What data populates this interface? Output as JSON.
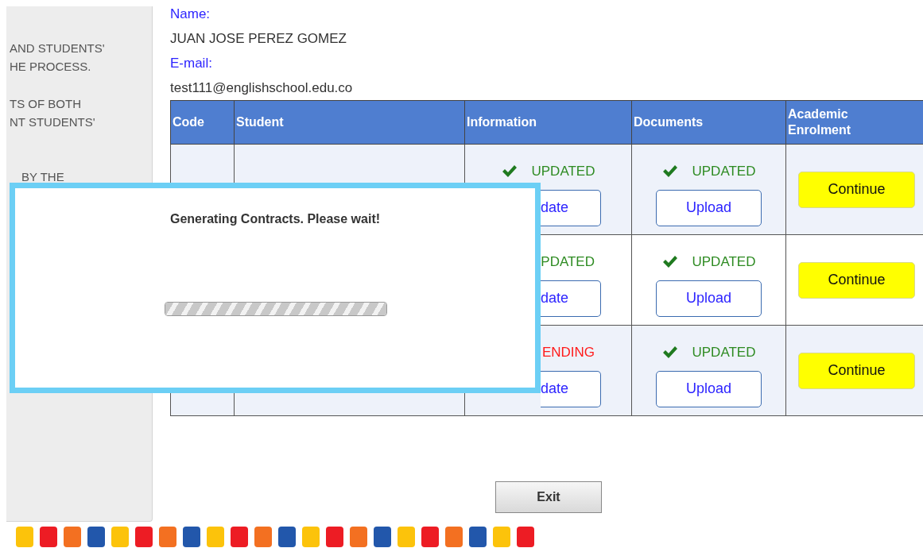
{
  "sidebar": {
    "paragraphs": [
      [
        "AND STUDENTS'",
        "HE PROCESS."
      ],
      [
        "TS OF BOTH",
        "NT STUDENTS'"
      ],
      [
        "BY THE"
      ]
    ]
  },
  "profile": {
    "name_label": "Name:",
    "name": "JUAN JOSE PEREZ GOMEZ",
    "email_label": "E-mail:",
    "email": "test111@englishschool.edu.co"
  },
  "table": {
    "columns": [
      "Code",
      "Student",
      "Information",
      "Documents",
      "Academic Enrolment"
    ],
    "rows": [
      {
        "information": {
          "status": "UPDATED",
          "kind": "updated",
          "button": "date",
          "cut": false,
          "button_cut": true
        },
        "documents": {
          "status": "UPDATED",
          "kind": "updated",
          "button": "Upload"
        },
        "enrolment_button": "Continue"
      },
      {
        "information": {
          "status": "PDATED",
          "kind": "updated",
          "button": "date",
          "cut": true,
          "button_cut": true
        },
        "documents": {
          "status": "UPDATED",
          "kind": "updated",
          "button": "Upload"
        },
        "enrolment_button": "Continue"
      },
      {
        "information": {
          "status": "ENDING",
          "kind": "pending",
          "button": "date",
          "cut": true,
          "button_cut": true
        },
        "documents": {
          "status": "UPDATED",
          "kind": "updated",
          "button": "Upload"
        },
        "enrolment_button": "Continue"
      }
    ]
  },
  "exit_button": "Exit",
  "modal": {
    "message": "Generating Contracts. Please wait!",
    "progress": {
      "level": 1
    }
  },
  "color_strip": [
    {
      "color": "#fcc30b"
    },
    {
      "color": "#ed1c24"
    },
    {
      "color": "#f37021"
    },
    {
      "color": "#2257ab"
    },
    {
      "color": "#fcc30b"
    },
    {
      "color": "#ed1c24"
    },
    {
      "color": "#f37021"
    },
    {
      "color": "#2257ab"
    },
    {
      "color": "#fcc30b"
    },
    {
      "color": "#ed1c24"
    },
    {
      "color": "#f37021"
    },
    {
      "color": "#2257ab"
    },
    {
      "color": "#fcc30b"
    },
    {
      "color": "#ed1c24"
    },
    {
      "color": "#f37021"
    },
    {
      "color": "#2257ab"
    },
    {
      "color": "#fcc30b"
    },
    {
      "color": "#ed1c24"
    },
    {
      "color": "#f37021"
    },
    {
      "color": "#2257ab"
    },
    {
      "color": "#fcc30b"
    },
    {
      "color": "#ed1c24"
    }
  ]
}
